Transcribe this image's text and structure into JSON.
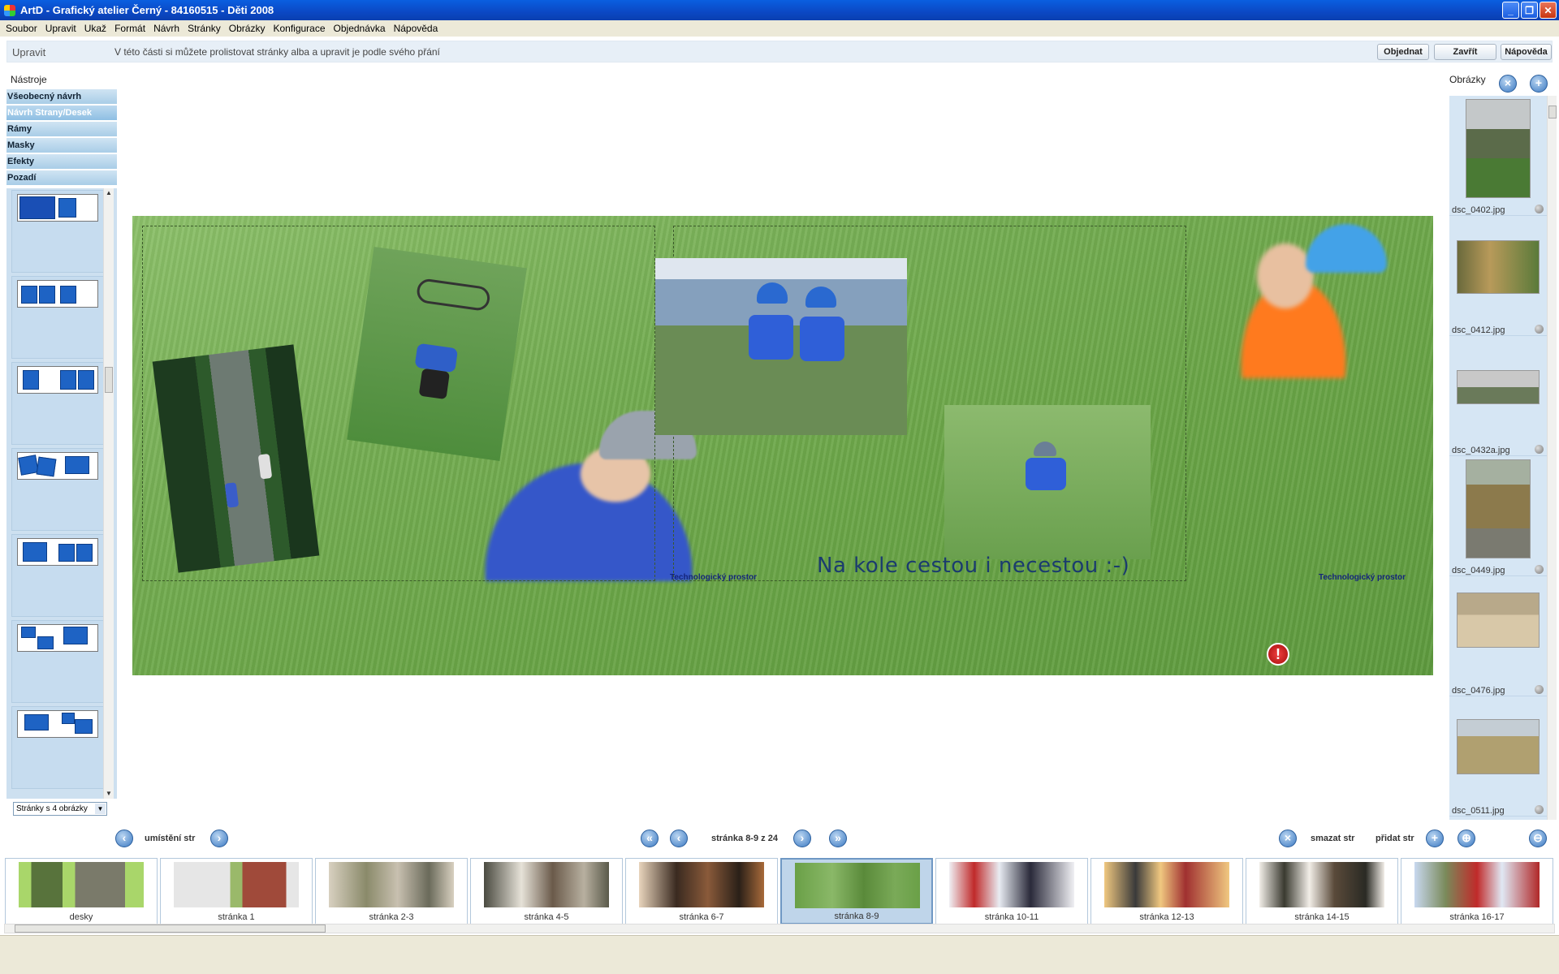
{
  "window": {
    "title": "ArtD - Grafický atelier Černý - 84160515 - Děti 2008",
    "minimize_icon": "minimize-icon",
    "maximize_icon": "maximize-icon",
    "close_icon": "close-icon"
  },
  "menu": [
    "Soubor",
    "Upravit",
    "Ukaž",
    "Formát",
    "Návrh",
    "Stránky",
    "Obrázky",
    "Konfigurace",
    "Objednávka",
    "Nápověda"
  ],
  "header": {
    "section": "Upravit",
    "hint": "V této části si můžete prolistovat stránky alba a upravit je podle svého přání",
    "order_button": "Objednat",
    "close_button": "Zavřít",
    "help_button": "Nápověda"
  },
  "tools": {
    "title": "Nástroje",
    "categories": [
      "Všeobecný návrh",
      "Návrh Strany/Desek",
      "Rámy",
      "Masky",
      "Efekty",
      "Pozadí"
    ],
    "active_category": "Návrh Strany/Desek",
    "page_select": "Stránky s 4 obrázky"
  },
  "spread": {
    "caption": "Na kole cestou i necestou :-)",
    "left_label": "Technologický prostor",
    "right_label": "Technologický prostor",
    "warning_icon": "warning-icon",
    "background_color": "#74ad52"
  },
  "images": {
    "title": "Obrázky",
    "remove_icon": "remove-icon",
    "add_icon": "add-icon",
    "files": [
      "dsc_0402.jpg",
      "dsc_0412.jpg",
      "dsc_0432a.jpg",
      "dsc_0449.jpg",
      "dsc_0476.jpg",
      "dsc_0511.jpg"
    ]
  },
  "nav": {
    "placement_label": "umístění str",
    "page_indicator": "stránka 8-9 z 24",
    "delete_label": "smazat str",
    "add_label": "přidat str"
  },
  "filmstrip": [
    "desky",
    "stránka 1",
    "stránka 2-3",
    "stránka 4-5",
    "stránka 6-7",
    "stránka 8-9",
    "stránka 10-11",
    "stránka 12-13",
    "stránka 14-15",
    "stránka 16-17"
  ],
  "filmstrip_active": "stránka 8-9"
}
